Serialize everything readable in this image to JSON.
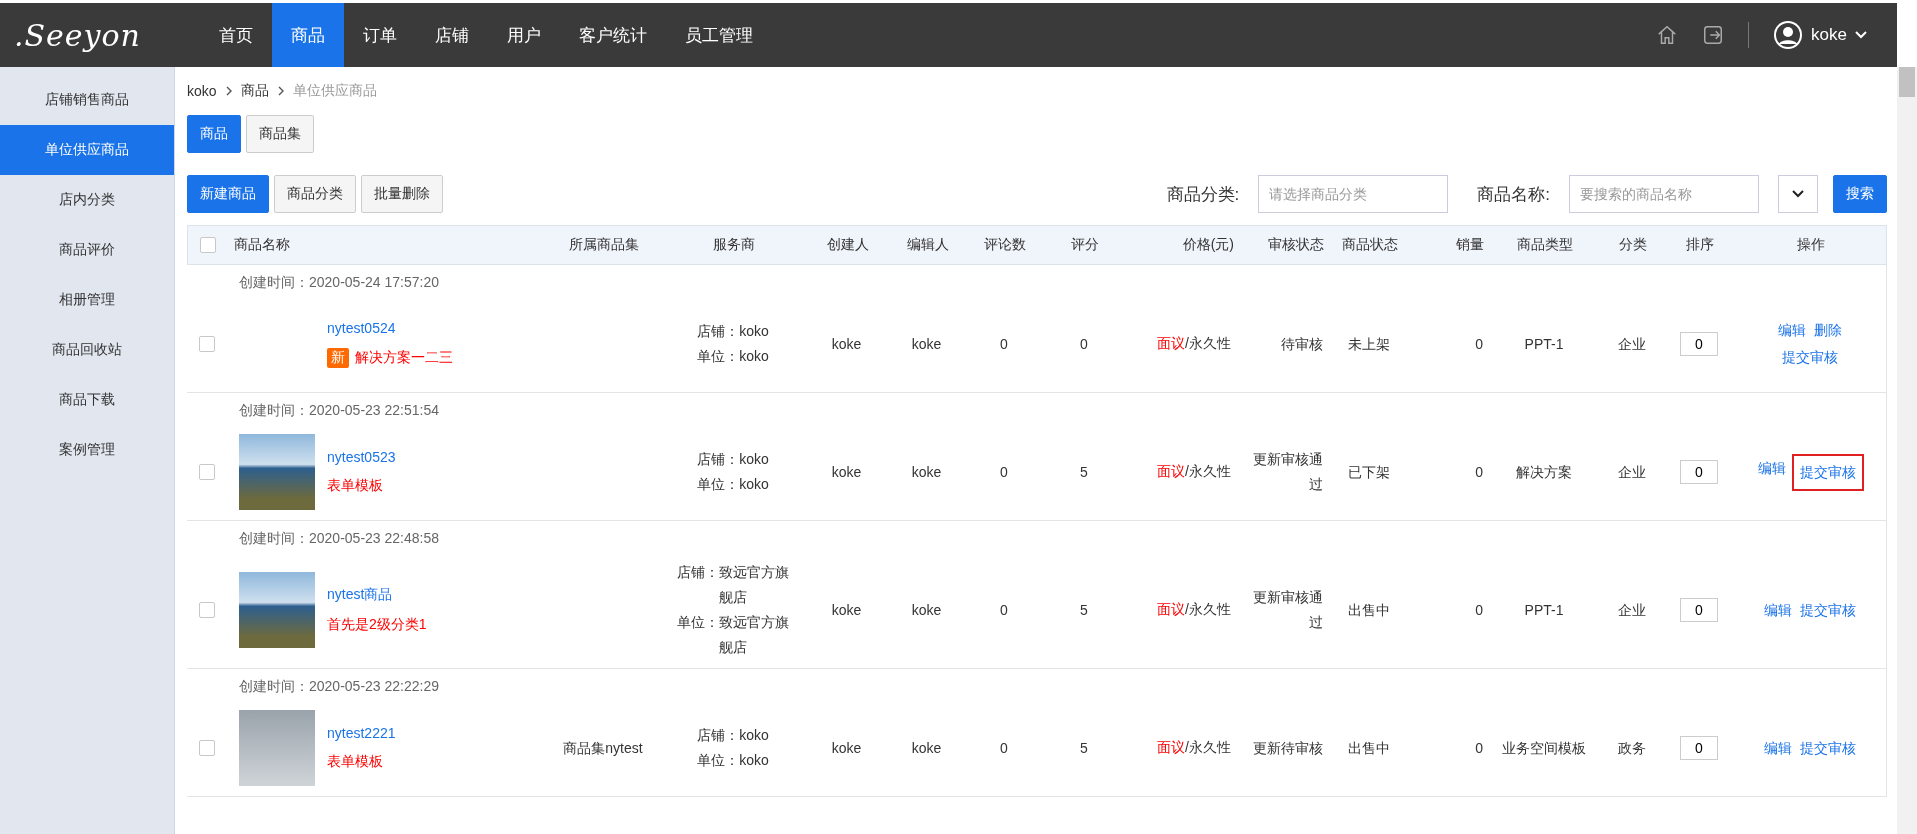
{
  "logo": {
    "text": ".Seeyon"
  },
  "nav": [
    {
      "label": "首页",
      "selected": false
    },
    {
      "label": "商品",
      "selected": true
    },
    {
      "label": "订单",
      "selected": false
    },
    {
      "label": "店铺",
      "selected": false
    },
    {
      "label": "用户",
      "selected": false
    },
    {
      "label": "客户统计",
      "selected": false
    },
    {
      "label": "员工管理",
      "selected": false
    }
  ],
  "user": {
    "name": "koke"
  },
  "sidebar": {
    "items": [
      {
        "label": "店铺销售商品",
        "selected": false
      },
      {
        "label": "单位供应商品",
        "selected": true
      },
      {
        "label": "店内分类",
        "selected": false
      },
      {
        "label": "商品评价",
        "selected": false
      },
      {
        "label": "相册管理",
        "selected": false
      },
      {
        "label": "商品回收站",
        "selected": false
      },
      {
        "label": "商品下载",
        "selected": false
      },
      {
        "label": "案例管理",
        "selected": false
      }
    ]
  },
  "breadcrumb": [
    "koko",
    "商品",
    "单位供应商品"
  ],
  "tabs": [
    {
      "label": "商品",
      "selected": true
    },
    {
      "label": "商品集",
      "selected": false
    }
  ],
  "toolbar": {
    "buttons": [
      {
        "label": "新建商品",
        "kind": "primary"
      },
      {
        "label": "商品分类",
        "kind": "default"
      },
      {
        "label": "批量删除",
        "kind": "default"
      }
    ],
    "filters": [
      {
        "label": "商品分类:",
        "placeholder": "请选择商品分类"
      },
      {
        "label": "商品名称:",
        "placeholder": "要搜索的商品名称"
      }
    ],
    "search_button": "搜索"
  },
  "table": {
    "select_all": {
      "checked": false
    },
    "columns": [
      "商品名称",
      "所属商品集",
      "服务商",
      "创建人",
      "编辑人",
      "评论数",
      "评分",
      "价格(元)",
      "审核状态",
      "商品状态",
      "销量",
      "商品类型",
      "分类",
      "排序",
      "操作"
    ],
    "rows": [
      {
        "created": "创建时间：2020-05-24 17:57:20",
        "checked": false,
        "kind": "blank",
        "name": "nytest0524",
        "badge": "新",
        "subtitle": "解决方案一二三",
        "set": "",
        "provider": [
          "店铺：koko",
          "单位：koko"
        ],
        "creator": "koke",
        "editor": "koke",
        "reviews": "0",
        "score": "0",
        "price_red": "面议",
        "price_rest": "/永久性",
        "audit": "待审核",
        "status": "未上架",
        "sales": "0",
        "type": "PPT-1",
        "category": "企业",
        "order": "0",
        "actions": [
          {
            "label": "编辑",
            "highlighted": false
          },
          {
            "label": "删除",
            "highlighted": false
          },
          {
            "label": "提交审核",
            "highlighted": false
          }
        ]
      },
      {
        "created": "创建时间：2020-05-23 22:51:54",
        "checked": false,
        "kind": "landscape",
        "name": "nytest0523",
        "subtitle": "表单模板",
        "set": "",
        "provider": [
          "店铺：koko",
          "单位：koko"
        ],
        "creator": "koke",
        "editor": "koke",
        "reviews": "0",
        "score": "5",
        "price_red": "面议",
        "price_rest": "/永久性",
        "audit": "更新审核通过",
        "status": "已下架",
        "sales": "0",
        "type": "解决方案",
        "category": "企业",
        "order": "0",
        "actions": [
          {
            "label": "编辑",
            "highlighted": false
          },
          {
            "label": "提交审核",
            "highlighted": true
          }
        ]
      },
      {
        "created": "创建时间：2020-05-23 22:48:58",
        "checked": false,
        "kind": "landscape",
        "name": "nytest商品",
        "subtitle": "首先是2级分类1",
        "set": "",
        "provider": [
          "店铺：致远官方旗舰店",
          "单位：致远官方旗舰店"
        ],
        "creator": "koke",
        "editor": "koke",
        "reviews": "0",
        "score": "5",
        "price_red": "面议",
        "price_rest": "/永久性",
        "audit": "更新审核通过",
        "status": "出售中",
        "sales": "0",
        "type": "PPT-1",
        "category": "企业",
        "order": "0",
        "actions": [
          {
            "label": "编辑",
            "highlighted": false
          },
          {
            "label": "提交审核",
            "highlighted": false
          }
        ]
      },
      {
        "created": "创建时间：2020-05-23 22:22:29",
        "checked": false,
        "kind": "portrait",
        "name": "nytest2221",
        "subtitle": "表单模板",
        "set": "商品集nytest",
        "provider": [
          "店铺：koko",
          "单位：koko"
        ],
        "creator": "koke",
        "editor": "koke",
        "reviews": "0",
        "score": "5",
        "price_red": "面议",
        "price_rest": "/永久性",
        "audit": "更新待审核",
        "status": "出售中",
        "sales": "0",
        "type": "业务空间模板",
        "category": "政务",
        "order": "0",
        "actions": [
          {
            "label": "编辑",
            "highlighted": false
          },
          {
            "label": "提交审核",
            "highlighted": false
          }
        ]
      }
    ]
  }
}
